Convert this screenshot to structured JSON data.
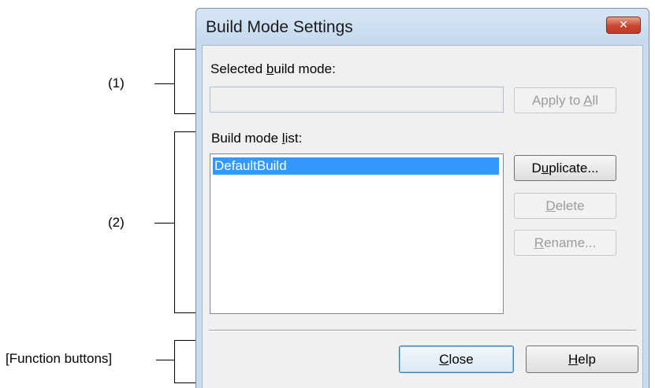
{
  "annotations": {
    "section1": "(1)",
    "section2": "(2)",
    "function_buttons": "[Function buttons]"
  },
  "dialog": {
    "title": "Build Mode Settings",
    "close_icon": "close-x-icon",
    "selected_build_mode": {
      "label_pre": "Selected ",
      "label_key": "b",
      "label_post": "uild mode:",
      "value": ""
    },
    "apply_to_all": {
      "pre": "Apply to ",
      "key": "A",
      "post": "ll",
      "enabled": false
    },
    "build_mode_list": {
      "label_pre": "Build mode ",
      "label_key": "l",
      "label_post": "ist:",
      "items": [
        "DefaultBuild"
      ],
      "selected_index": 0
    },
    "duplicate": {
      "pre": "D",
      "key": "u",
      "post": "plicate...",
      "enabled": true
    },
    "delete": {
      "pre": "",
      "key": "D",
      "post": "elete",
      "enabled": false
    },
    "rename": {
      "pre": "",
      "key": "R",
      "post": "ename...",
      "enabled": false
    },
    "close": {
      "pre": "",
      "key": "C",
      "post": "lose",
      "default": true
    },
    "help": {
      "pre": "",
      "key": "H",
      "post": "elp"
    }
  },
  "colors": {
    "titlebar": "#c8ddf1",
    "selection": "#3399ff",
    "close_button": "#c7472f"
  }
}
